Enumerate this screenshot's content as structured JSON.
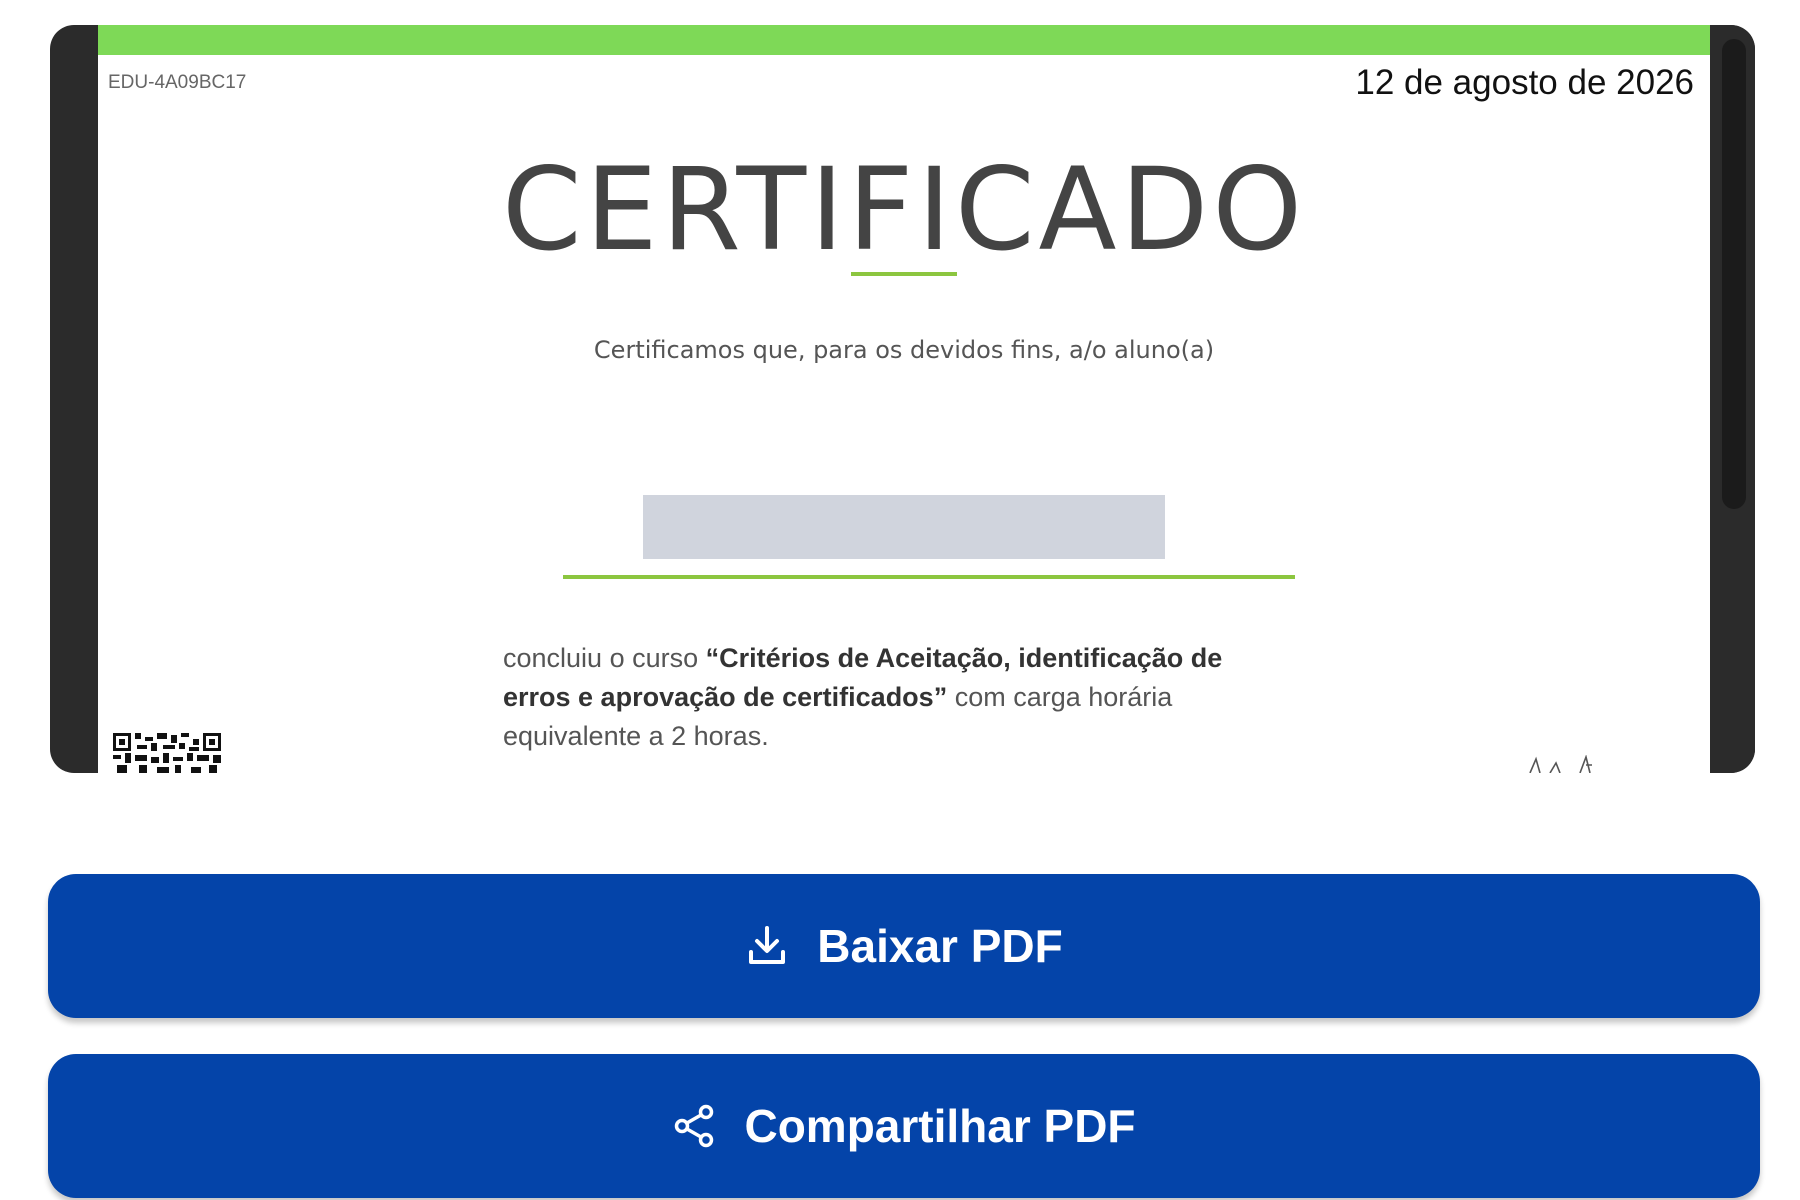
{
  "certificate": {
    "code": "EDU-4A09BC17",
    "date": "12 de agosto de 2026",
    "title": "CERTIFICADO",
    "intro": "Certificamos que, para os devidos fins, a/o aluno(a)",
    "body_prefix": "concluiu o curso ",
    "course_name": "“Critérios de Aceitação, identificação de erros e aprovação de certificados”",
    "body_suffix": " com carga horária equivalente a 2 horas."
  },
  "actions": {
    "download_label": "Baixar PDF",
    "share_label": "Compartilhar PDF"
  },
  "icons": {
    "download": "download-icon",
    "share": "share-icon",
    "qr": "qr-code-icon"
  },
  "colors": {
    "accent_green": "#7ed957",
    "rule_green": "#8cc63f",
    "button_blue": "#0444a9",
    "frame_dark": "#2b2b2b"
  }
}
